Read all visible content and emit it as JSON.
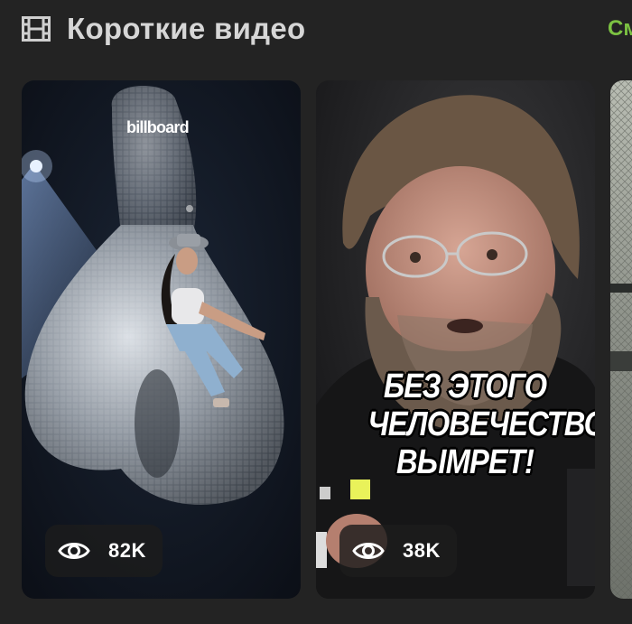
{
  "header": {
    "title": "Короткие видео",
    "see_all": "См",
    "icon": "film-icon"
  },
  "videos": [
    {
      "brand": "billboard",
      "views": "82K",
      "caption": []
    },
    {
      "brand": "",
      "views": "38K",
      "caption": [
        "БЕЗ ЭТОГО",
        "ЧЕЛОВЕЧЕСТВО",
        "ВЫМРЕТ!"
      ]
    }
  ],
  "colors": {
    "background": "#232323",
    "accent": "#7cc242",
    "title": "#d6d6d6"
  }
}
